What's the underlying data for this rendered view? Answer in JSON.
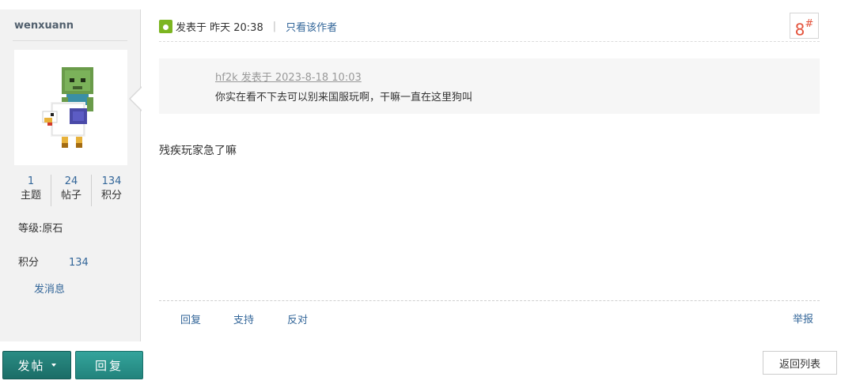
{
  "author": {
    "username": "wenxuann",
    "stats": [
      {
        "value": "1",
        "label": "主题"
      },
      {
        "value": "24",
        "label": "帖子"
      },
      {
        "value": "134",
        "label": "积分"
      }
    ],
    "level": "等级:原石",
    "points_label": "积分",
    "points_value": "134",
    "send_message": "发消息"
  },
  "post": {
    "posted_at": "发表于 昨天 20:38",
    "separator": "|",
    "only_author": "只看该作者",
    "floor_number": "8",
    "floor_mark": "#",
    "quote": {
      "meta": "hf2k 发表于 2023-8-18 10:03",
      "text": "你实在看不下去可以别来国服玩啊，干嘛一直在这里狗叫"
    },
    "content": "残疾玩家急了嘛",
    "actions": {
      "reply": "回复",
      "support": "支持",
      "oppose": "反对",
      "report": "举报"
    }
  },
  "bottom": {
    "post_button": "发帖",
    "reply_button": "回复",
    "back_to_list": "返回列表"
  },
  "colors": {
    "link": "#336699",
    "floor": "#e4533c",
    "button_teal": "#22837c",
    "sidebar_bg": "#f2f2f2"
  }
}
